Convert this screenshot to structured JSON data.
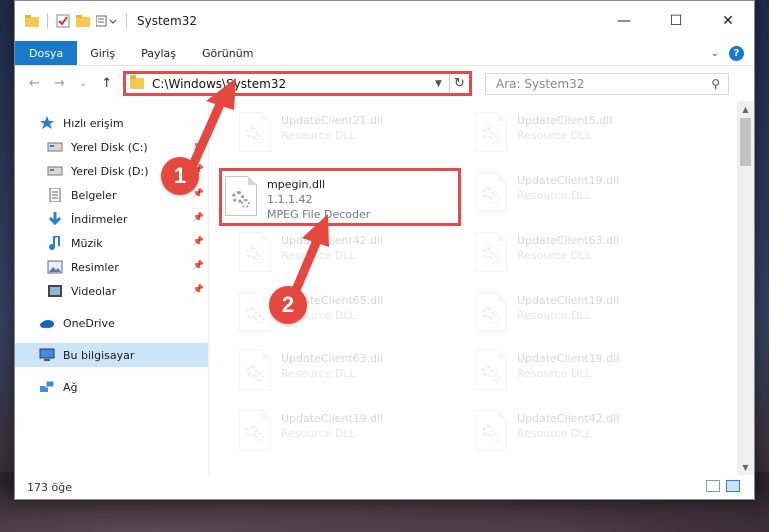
{
  "window": {
    "title": "System32",
    "controls": {
      "minimize": "—",
      "maximize": "☐",
      "close": "✕"
    }
  },
  "ribbon": {
    "tabs": [
      "Dosya",
      "Giriş",
      "Paylaş",
      "Görünüm"
    ],
    "help_label": "?"
  },
  "nav": {
    "back": "←",
    "forward": "→",
    "recent": "⌄",
    "up": "↑",
    "address": "C:\\Windows\\System32",
    "refresh": "↻",
    "search_placeholder": "Ara: System32"
  },
  "sidebar": {
    "items": [
      {
        "label": "Hızlı erişim",
        "icon": "star-icon",
        "pinned": false
      },
      {
        "label": "Yerel Disk (C:)",
        "icon": "drive-icon",
        "pinned": true
      },
      {
        "label": "Yerel Disk (D:)",
        "icon": "drive-icon",
        "pinned": true
      },
      {
        "label": "Belgeler",
        "icon": "documents-icon",
        "pinned": true
      },
      {
        "label": "İndirmeler",
        "icon": "download-icon",
        "pinned": true
      },
      {
        "label": "Müzik",
        "icon": "music-icon",
        "pinned": true
      },
      {
        "label": "Resimler",
        "icon": "pictures-icon",
        "pinned": true
      },
      {
        "label": "Videolar",
        "icon": "videos-icon",
        "pinned": true
      },
      {
        "label": "OneDrive",
        "icon": "cloud-icon",
        "pinned": false
      },
      {
        "label": "Bu bilgisayar",
        "icon": "computer-icon",
        "pinned": false
      },
      {
        "label": "Ağ",
        "icon": "network-icon",
        "pinned": false
      }
    ]
  },
  "files": {
    "highlighted": {
      "name": "mpegin.dll",
      "version": "1.1.1.42",
      "description": "MPEG File Decoder"
    },
    "left_column": [
      {
        "name": "UpdateClient21.dll",
        "type": "Resource DLL"
      },
      {
        "name": "UpdateClient42.dll",
        "type": "Resource DLL"
      },
      {
        "name": "UpdateClient65.dll",
        "type": "Resource DLL"
      },
      {
        "name": "UpdateClient63.dll",
        "type": "Resource DLL"
      },
      {
        "name": "UpdateClient19.dll",
        "type": "Resource DLL"
      }
    ],
    "right_column": [
      {
        "name": "UpdateClient5.dll",
        "type": "Resource DLL"
      },
      {
        "name": "UpdateClient19.dll",
        "type": "Resource DLL"
      },
      {
        "name": "UpdateClient63.dll",
        "type": "Resource DLL"
      },
      {
        "name": "UpdateClient19.dll",
        "type": "Resource DLL"
      },
      {
        "name": "UpdateClient19.dll",
        "type": "Resource DLL"
      },
      {
        "name": "UpdateClient42.dll",
        "type": "Resource DLL"
      }
    ]
  },
  "status": {
    "item_count": "173 öğe"
  },
  "annotations": {
    "step1": "1",
    "step2": "2",
    "color": "#e5483f"
  }
}
